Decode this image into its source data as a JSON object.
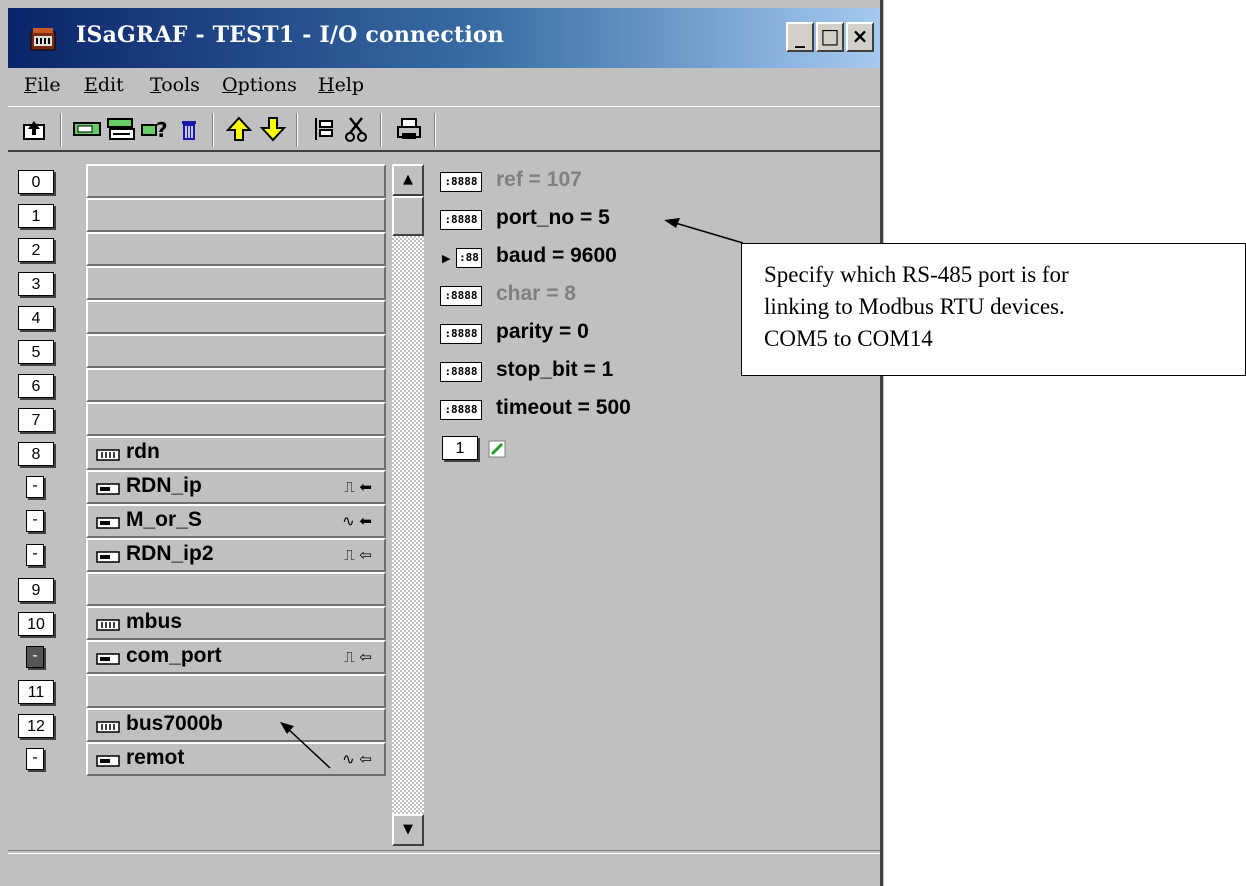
{
  "window": {
    "title": "ISaGRAF - TEST1 - I/O connection",
    "buttons": {
      "minimize": "_",
      "maximize": "□",
      "close": "×"
    }
  },
  "menu": [
    {
      "label": "File",
      "u": "F",
      "rest": "ile"
    },
    {
      "label": "Edit",
      "u": "E",
      "rest": "dit"
    },
    {
      "label": "Tools",
      "u": "T",
      "rest": "ools"
    },
    {
      "label": "Options",
      "u": "O",
      "rest": "ptions"
    },
    {
      "label": "Help",
      "u": "H",
      "rest": "elp"
    }
  ],
  "toolbar_icons": [
    "open-icon",
    "connect-board-icon",
    "board-params-icon",
    "help-query-icon",
    "delete-icon",
    "move-up-icon",
    "move-down-icon",
    "insert-icon",
    "cut-icon",
    "print-icon"
  ],
  "slots": [
    {
      "n": "0",
      "label": ""
    },
    {
      "n": "1",
      "label": ""
    },
    {
      "n": "2",
      "label": ""
    },
    {
      "n": "3",
      "label": ""
    },
    {
      "n": "4",
      "label": ""
    },
    {
      "n": "5",
      "label": ""
    },
    {
      "n": "6",
      "label": ""
    },
    {
      "n": "7",
      "label": ""
    },
    {
      "n": "8",
      "label": "rdn"
    },
    {
      "n": "-",
      "label": "RDN_ip",
      "flags": "⎍ ⬅"
    },
    {
      "n": "-",
      "label": "M_or_S",
      "flags": "∿ ⬅"
    },
    {
      "n": "-",
      "label": "RDN_ip2",
      "flags": "⎍ ⇦"
    },
    {
      "n": "9",
      "label": ""
    },
    {
      "n": "10",
      "label": "mbus"
    },
    {
      "n": "-",
      "label": "com_port",
      "flags": "⎍ ⇦"
    },
    {
      "n": "11",
      "label": ""
    },
    {
      "n": "12",
      "label": "bus7000b"
    },
    {
      "n": "-",
      "label": "remot",
      "flags": "∿ ⇦"
    }
  ],
  "params": [
    {
      "text": "ref = 107",
      "dim": true
    },
    {
      "text": "port_no = 5",
      "dim": false
    },
    {
      "text": "baud = 9600",
      "dim": false,
      "selected": true
    },
    {
      "text": "char = 8",
      "dim": true
    },
    {
      "text": "parity = 0",
      "dim": false
    },
    {
      "text": "stop_bit = 1",
      "dim": false
    },
    {
      "text": "timeout = 500",
      "dim": false
    }
  ],
  "param_index": "1",
  "callout": {
    "line1": "Specify which RS-485 port is for",
    "line2": "linking to Modbus RTU devices.",
    "line3": "COM5 to COM14"
  }
}
